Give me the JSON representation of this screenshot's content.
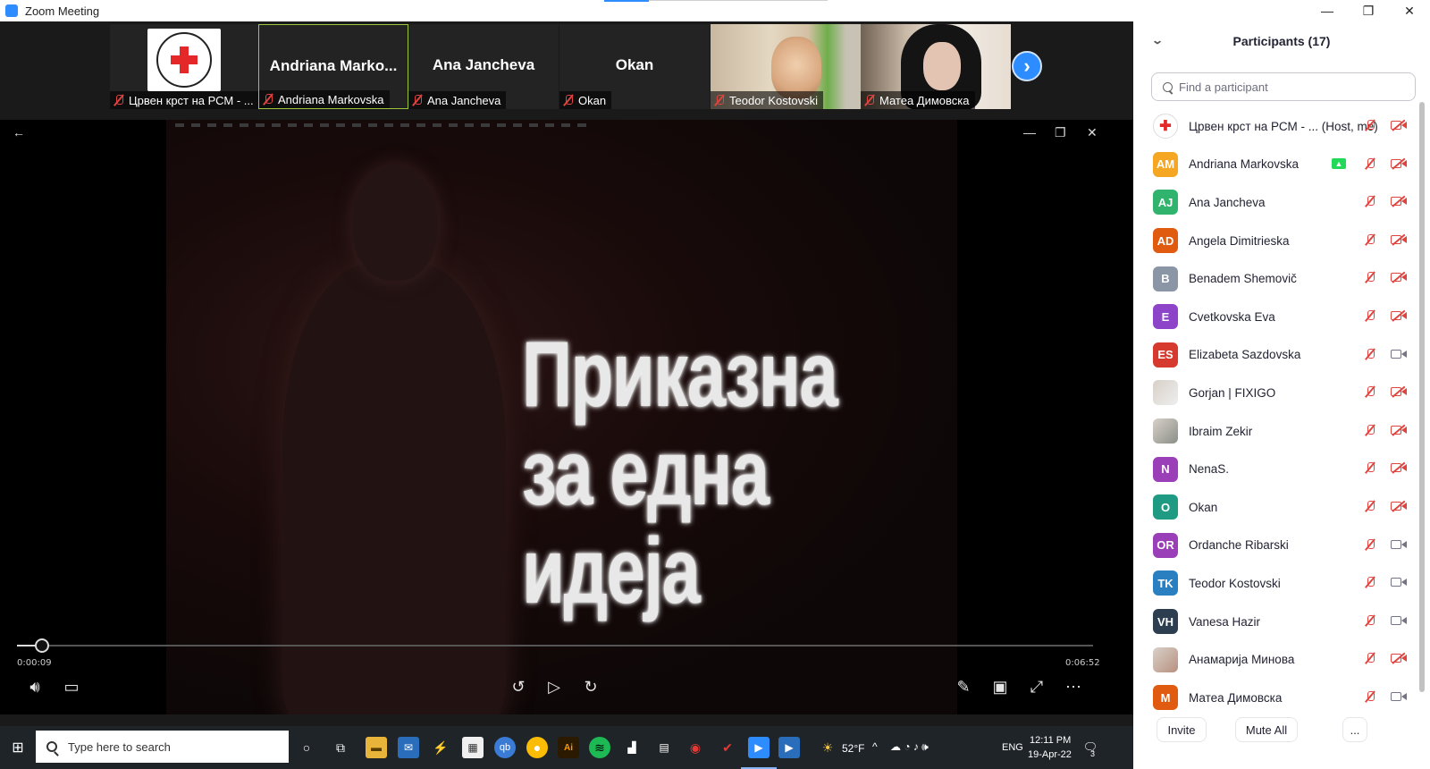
{
  "window": {
    "title": "Zoom Meeting",
    "controls": [
      "—",
      "❐",
      "✕"
    ]
  },
  "strip": {
    "tiles": [
      {
        "big_name": "",
        "label": "Црвен крст на РСМ - ...",
        "kind": "logo"
      },
      {
        "big_name": "Andriana  Marko...",
        "label": "Andriana Markovska",
        "kind": "name",
        "active": true
      },
      {
        "big_name": "Ana Jancheva",
        "label": "Ana Jancheva",
        "kind": "name"
      },
      {
        "big_name": "Okan",
        "label": "Okan",
        "kind": "name"
      },
      {
        "big_name": "",
        "label": "Teodor Kostovski",
        "kind": "photo"
      },
      {
        "big_name": "",
        "label": "Матеа Димовска",
        "kind": "photo"
      }
    ],
    "next_glyph": "›"
  },
  "video": {
    "overlay_text_lines": [
      "Приказна",
      "за една",
      "идеја"
    ],
    "time_elapsed": "0:00:09",
    "time_total": "0:06:52",
    "progress_fraction": 0.023
  },
  "taskbar": {
    "search_placeholder": "Type here to search",
    "weather": "52°F",
    "language": "ENG",
    "time": "12:11 PM",
    "date": "19-Apr-22",
    "notification_count": "3",
    "mail_badge": "1"
  },
  "participants": {
    "header": "Participants (17)",
    "search_placeholder": "Find a participant",
    "items": [
      {
        "initials": "",
        "name": "Црвен крст на РСМ - ...   (Host, me)",
        "color": "#ffffff",
        "kind": "logo",
        "cam_on": false
      },
      {
        "initials": "AM",
        "name": "Andriana Markovska",
        "color": "#f5a623",
        "cam_on": false,
        "sharing": true
      },
      {
        "initials": "AJ",
        "name": "Ana Jancheva",
        "color": "#2fb36d",
        "cam_on": false
      },
      {
        "initials": "AD",
        "name": "Angela Dimitrieska",
        "color": "#e05a10",
        "cam_on": false
      },
      {
        "initials": "B",
        "name": "Benadem Shemovič",
        "color": "#8a96a6",
        "cam_on": false
      },
      {
        "initials": "E",
        "name": "Cvetkovska Eva",
        "color": "#8e44c9",
        "cam_on": false
      },
      {
        "initials": "ES",
        "name": "Elizabeta Sazdovska",
        "color": "#d63a2f",
        "cam_on": true
      },
      {
        "initials": "",
        "name": "Gorjan | FIXIGO",
        "color": "#eeeeee",
        "kind": "img",
        "cam_on": false
      },
      {
        "initials": "",
        "name": "Ibraim Zekir",
        "color": "#8a8f88",
        "kind": "img",
        "cam_on": false
      },
      {
        "initials": "N",
        "name": "NenaS.",
        "color": "#9b3fb9",
        "cam_on": false
      },
      {
        "initials": "O",
        "name": "Okan",
        "color": "#1f9a83",
        "cam_on": false
      },
      {
        "initials": "OR",
        "name": "Ordanche Ribarski",
        "color": "#9b3fb9",
        "cam_on": true
      },
      {
        "initials": "TK",
        "name": "Teodor Kostovski",
        "color": "#2a7fc0",
        "cam_on": true
      },
      {
        "initials": "VH",
        "name": "Vanesa Hazir",
        "color": "#2d3e50",
        "cam_on": true
      },
      {
        "initials": "",
        "name": "Анамарија Минова",
        "color": "#b89080",
        "kind": "img",
        "cam_on": false
      },
      {
        "initials": "M",
        "name": "Матеа Димовска",
        "color": "#e05a10",
        "cam_on": true
      }
    ],
    "footer": {
      "invite": "Invite",
      "mute_all": "Mute All",
      "more": "..."
    }
  },
  "colors": {
    "accent": "#2d8cff",
    "mute_red": "#e0443e",
    "active_border": "#9cc63c"
  }
}
